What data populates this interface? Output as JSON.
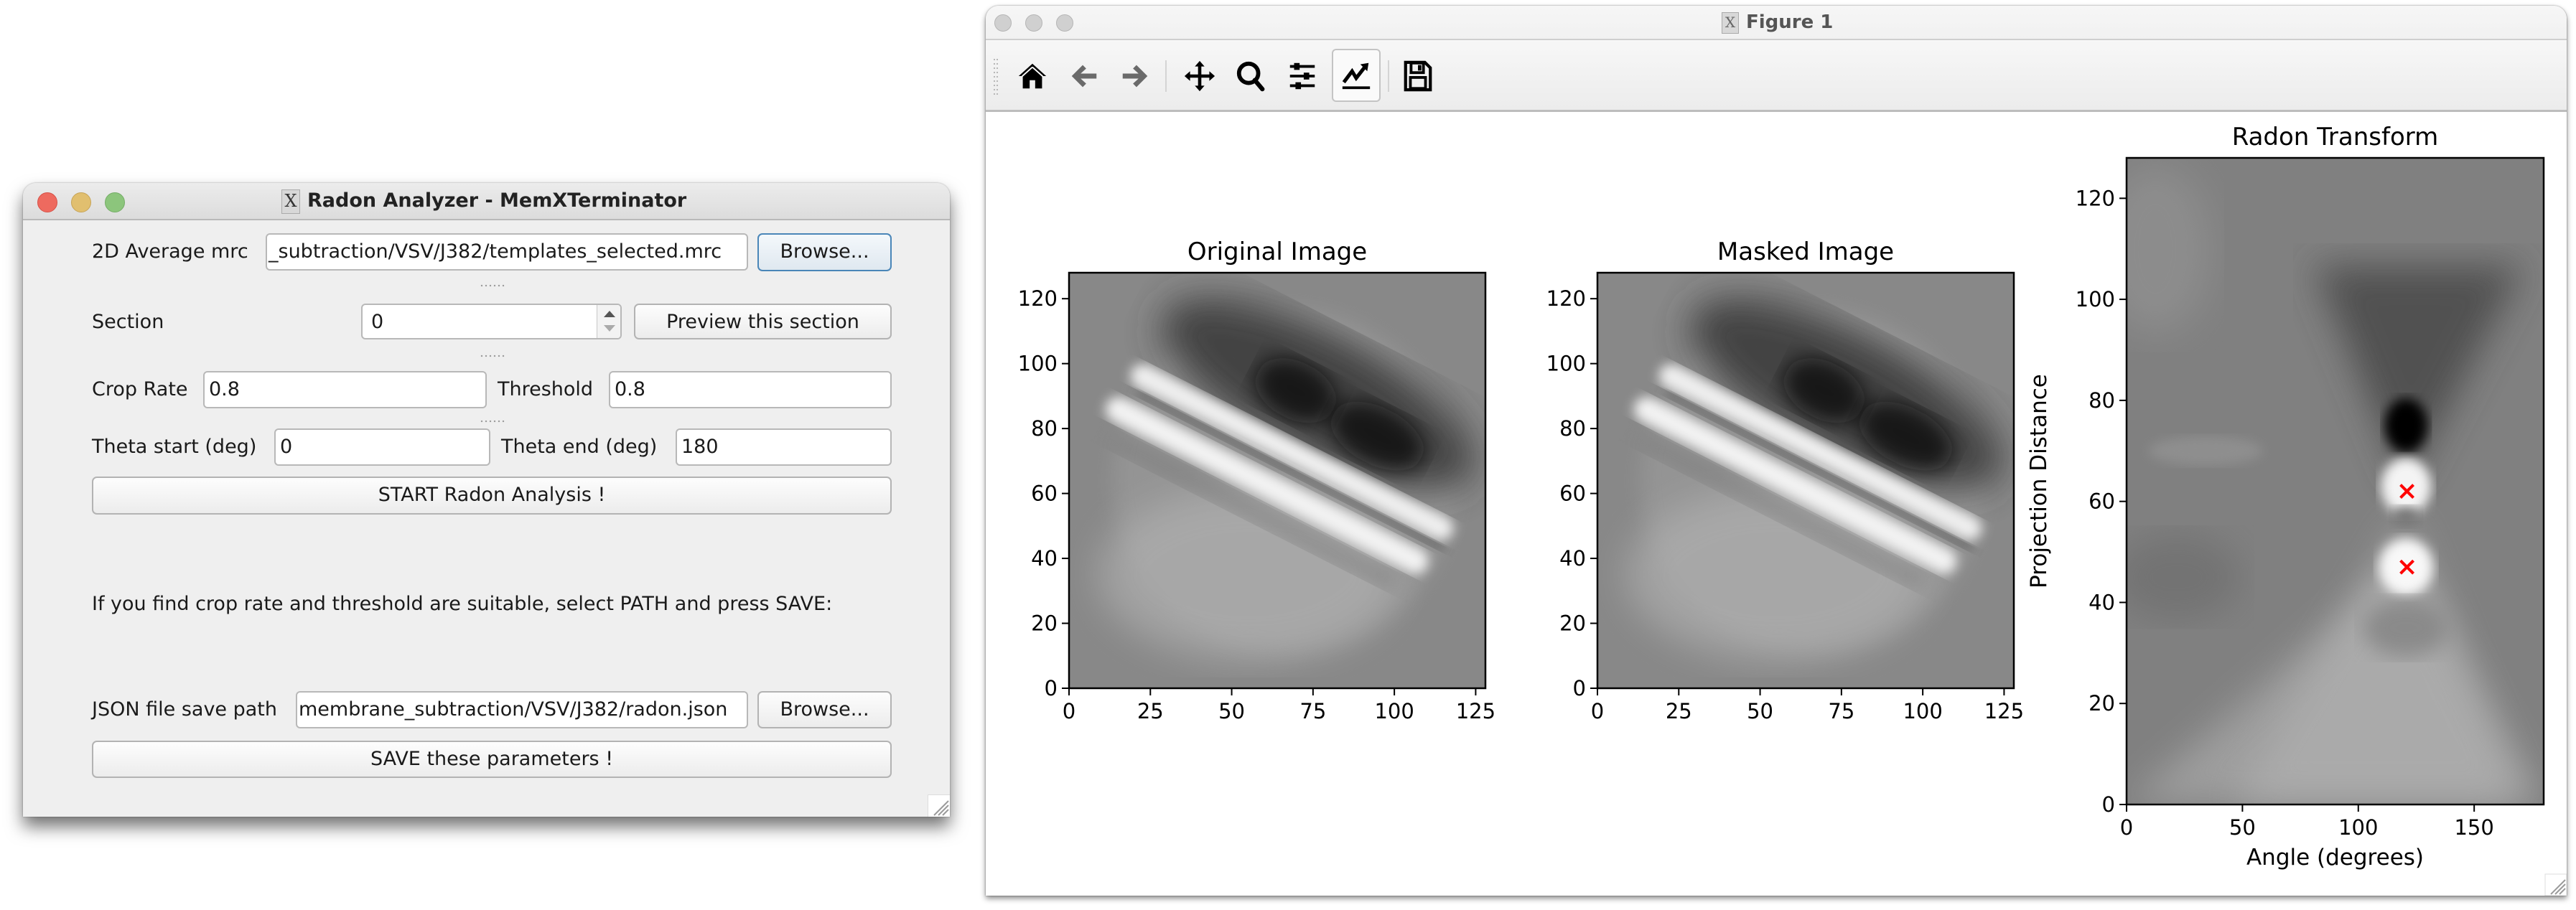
{
  "radon_analyzer": {
    "title": "Radon Analyzer - MemXTerminator",
    "window_controls": [
      "close",
      "minimize",
      "zoom"
    ],
    "mrc": {
      "label": "2D Average mrc",
      "value": "_subtraction/VSV/J382/templates_selected.mrc",
      "browse_label": "Browse..."
    },
    "section": {
      "label": "Section",
      "value": "0",
      "preview_label": "Preview this section"
    },
    "crop_rate": {
      "label": "Crop Rate",
      "value": "0.8"
    },
    "threshold": {
      "label": "Threshold",
      "value": "0.8"
    },
    "theta_start": {
      "label": "Theta start (deg)",
      "value": "0"
    },
    "theta_end": {
      "label": "Theta end (deg)",
      "value": "180"
    },
    "start_label": "START Radon Analysis !",
    "info_text": "If you find crop rate and threshold are suitable, select PATH and press SAVE:",
    "json_path": {
      "label": "JSON file save path",
      "value": "membrane_subtraction/VSV/J382/radon.json",
      "browse_label": "Browse..."
    },
    "save_label": "SAVE these parameters !"
  },
  "figure_window": {
    "title": "Figure 1",
    "toolbar": [
      {
        "name": "home-icon",
        "tooltip": "Home"
      },
      {
        "name": "back-icon",
        "tooltip": "Back"
      },
      {
        "name": "forward-icon",
        "tooltip": "Forward"
      },
      {
        "name": "pan-icon",
        "tooltip": "Pan"
      },
      {
        "name": "zoom-icon",
        "tooltip": "Zoom"
      },
      {
        "name": "subplots-icon",
        "tooltip": "Subplots"
      },
      {
        "name": "edit-curves-icon",
        "tooltip": "Customize",
        "pressed": true
      },
      {
        "name": "save-icon",
        "tooltip": "Save"
      }
    ]
  },
  "colors": {
    "close": "#ee6a5f",
    "minimize": "#e1bf6f",
    "zoom": "#8cc57c",
    "inactive_light": "#d0d0d0",
    "marker": "#ff0000"
  },
  "chart_data": [
    {
      "type": "heatmap",
      "title": "Original Image",
      "xlabel": "",
      "ylabel": "",
      "xlim": [
        0,
        128
      ],
      "ylim": [
        0,
        128
      ],
      "xticks": [
        0,
        25,
        50,
        75,
        100,
        125
      ],
      "yticks": [
        0,
        20,
        40,
        60,
        80,
        100,
        120
      ],
      "colormap": "gray",
      "description": "Circular 2D class average with a diagonal double-band membrane running from upper-left to lower-right"
    },
    {
      "type": "heatmap",
      "title": "Masked Image",
      "xlabel": "",
      "ylabel": "",
      "xlim": [
        0,
        128
      ],
      "ylim": [
        0,
        128
      ],
      "xticks": [
        0,
        25,
        50,
        75,
        100,
        125
      ],
      "yticks": [
        0,
        20,
        40,
        60,
        80,
        100,
        120
      ],
      "colormap": "gray",
      "description": "Same average after circular mask"
    },
    {
      "type": "heatmap",
      "title": "Radon Transform",
      "xlabel": "Angle (degrees)",
      "ylabel": "Projection Distance",
      "xlim": [
        0,
        180
      ],
      "ylim": [
        0,
        128
      ],
      "xticks": [
        0,
        50,
        100,
        150
      ],
      "yticks": [
        0,
        20,
        40,
        60,
        80,
        100,
        120
      ],
      "colormap": "gray",
      "markers": [
        {
          "x": 121,
          "y": 62,
          "symbol": "x",
          "color": "#ff0000"
        },
        {
          "x": 121,
          "y": 47,
          "symbol": "x",
          "color": "#ff0000"
        }
      ]
    }
  ]
}
